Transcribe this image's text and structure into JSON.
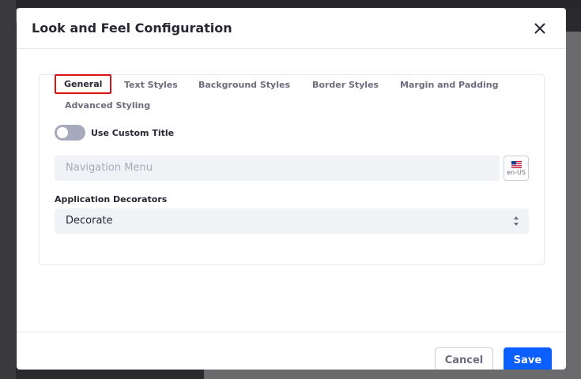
{
  "modal": {
    "title": "Look and Feel Configuration",
    "close_icon": "close-icon"
  },
  "tabs": [
    {
      "label": "General",
      "active": true
    },
    {
      "label": "Text Styles",
      "active": false
    },
    {
      "label": "Background Styles",
      "active": false
    },
    {
      "label": "Border Styles",
      "active": false
    },
    {
      "label": "Margin and Padding",
      "active": false
    },
    {
      "label": "Advanced Styling",
      "active": false
    }
  ],
  "general": {
    "custom_title_label": "Use Custom Title",
    "custom_title_enabled": false,
    "title_placeholder": "Navigation Menu",
    "title_value": "",
    "locale": "en-US",
    "locale_icon": "us-flag-icon",
    "decorators_label": "Application Decorators",
    "decorators_value": "Decorate"
  },
  "footer": {
    "cancel_label": "Cancel",
    "save_label": "Save"
  },
  "colors": {
    "primary": "#0b5fff",
    "highlight": "#da1414"
  }
}
